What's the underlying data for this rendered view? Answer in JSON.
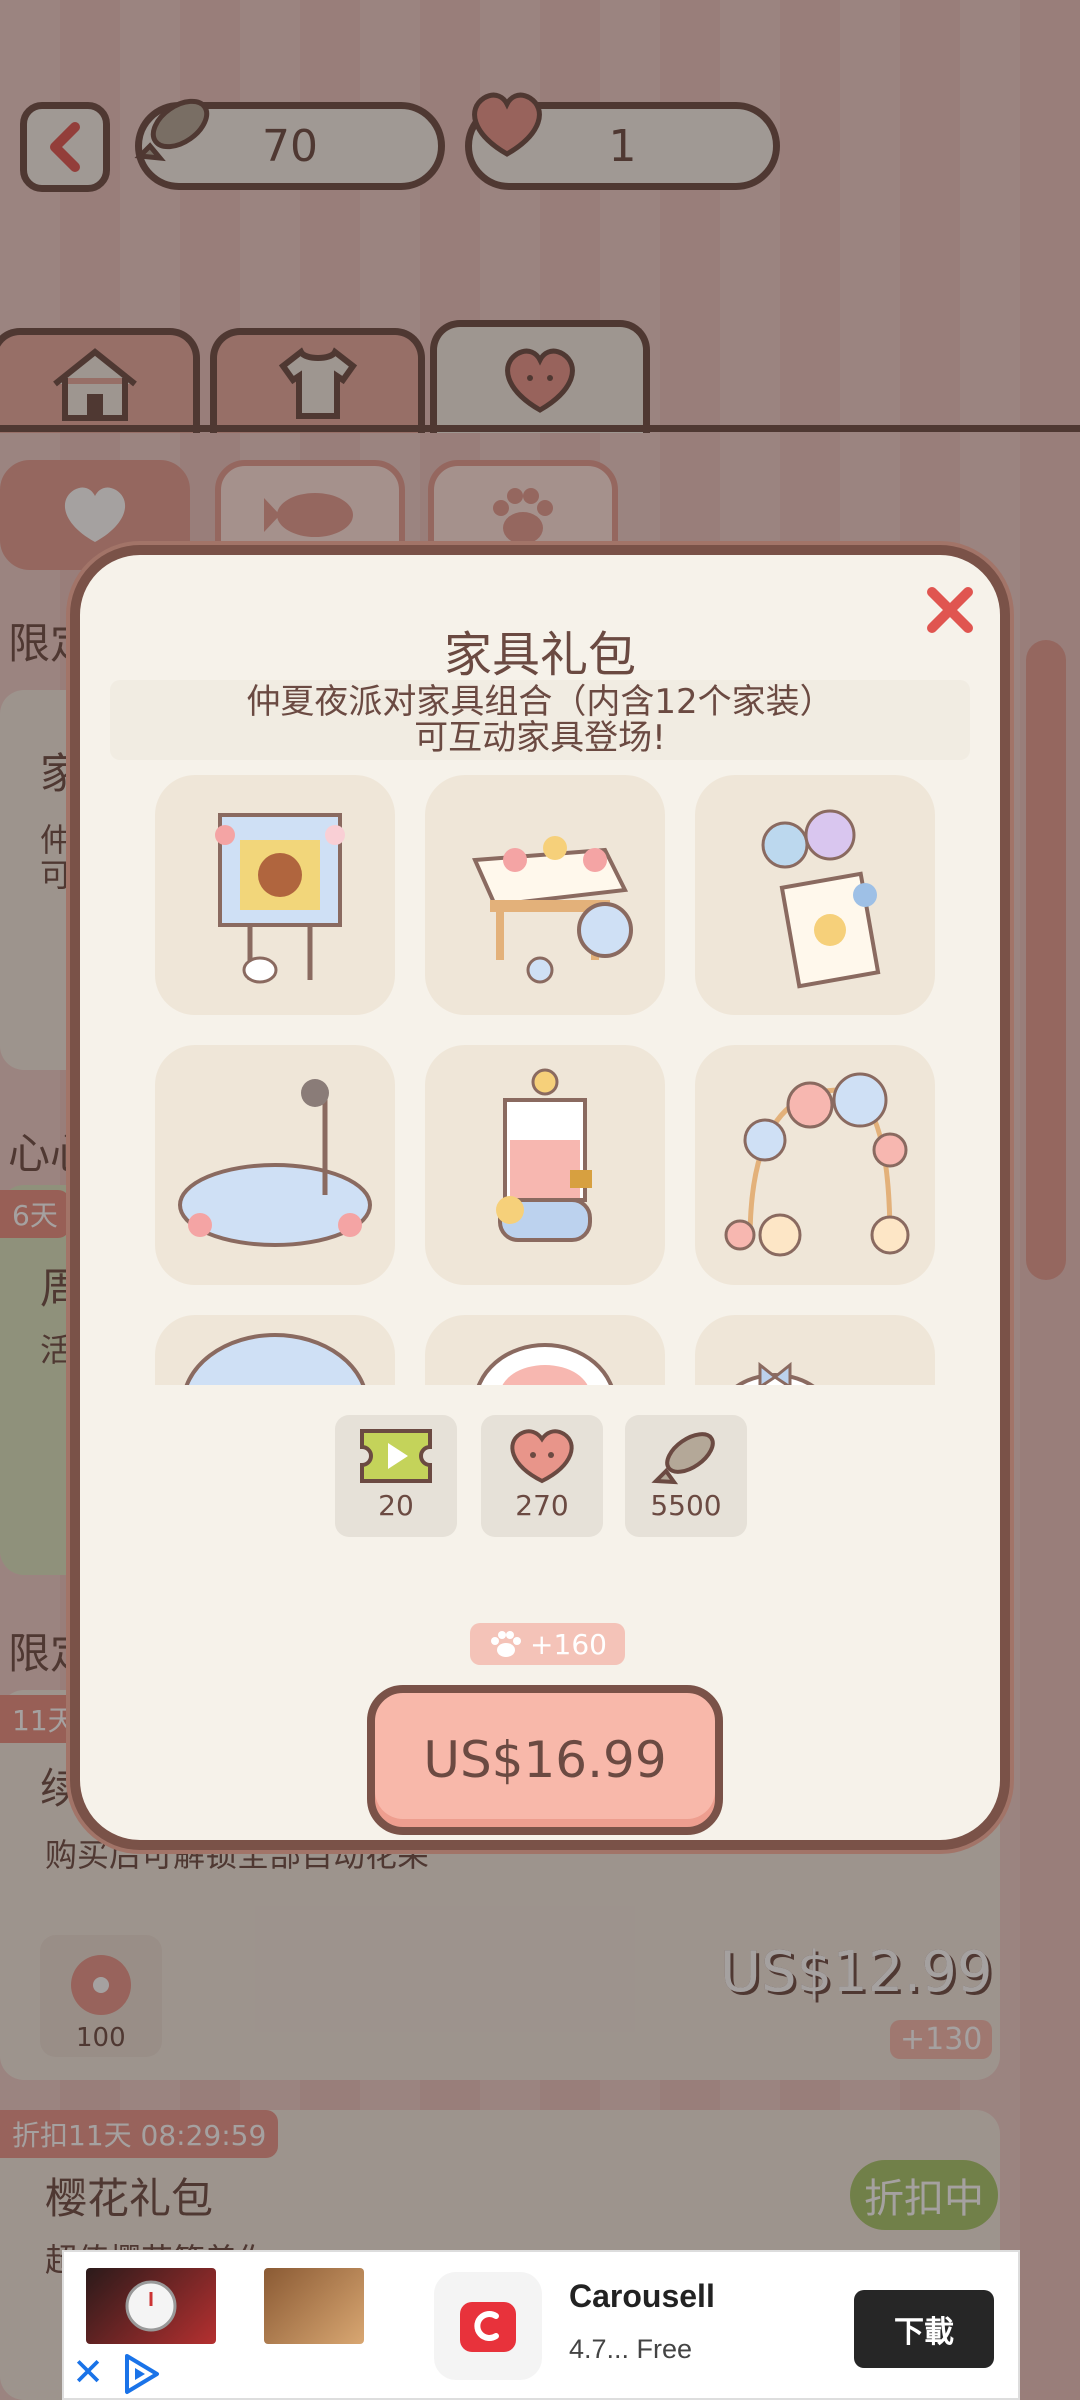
{
  "topbar": {
    "fish_count": "70",
    "heart_count": "1"
  },
  "background": {
    "section_limited": "限定",
    "section_heart": "心心",
    "card1_title": "家",
    "card1_line1": "仲",
    "card1_line2": "可",
    "tag_days": "6天",
    "card2_title": "周",
    "card2_line": "活",
    "section_limited2": "限定",
    "tag_11": "11天",
    "card3_title": "续",
    "card3_desc": "购买后可解锁全部自动花朵",
    "card3_reward": "100",
    "card3_price": "US$12.99",
    "card3_bonus": "+130",
    "card4_tag": "折扣11天 08:29:59",
    "card4_title": "樱花礼包",
    "card4_desc": "超值樱花等着你",
    "card4_discount": "折扣中"
  },
  "modal": {
    "title": "家具礼包",
    "desc_line1": "仲夏夜派对家具组合（内含12个家装）",
    "desc_line2": "可互动家具登场!",
    "items": [
      "poster-stand",
      "flower-cart",
      "balloon-sign",
      "stage-mic",
      "juice-dispenser",
      "balloon-arch",
      "plate",
      "cake",
      "gift"
    ],
    "rewards": [
      {
        "icon": "ticket-icon",
        "value": "20"
      },
      {
        "icon": "heart-icon",
        "value": "270"
      },
      {
        "icon": "fish-icon",
        "value": "5500"
      }
    ],
    "paw_bonus": "+160",
    "price": "US$16.99"
  },
  "ad": {
    "app_name": "Carousell",
    "rating": "4.7...  Free",
    "install_label": "下載"
  },
  "colors": {
    "brown": "#6b4a42",
    "pink": "#f8b8aa",
    "cream": "#f6f2ea"
  }
}
